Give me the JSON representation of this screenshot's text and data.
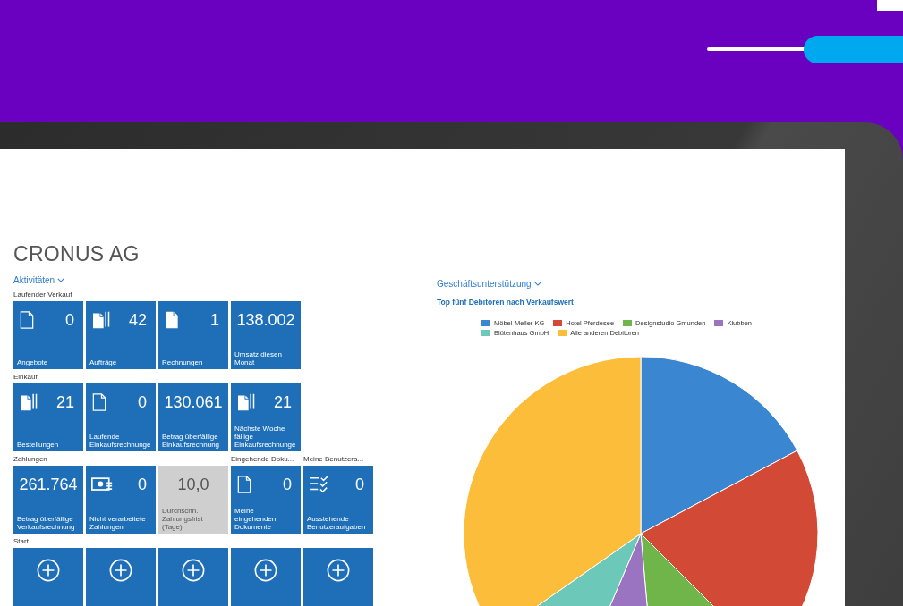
{
  "company": "CRONUS AG",
  "activities": {
    "link": "Aktivitäten",
    "rows": [
      {
        "groups": [
          {
            "title": "Laufender Verkauf",
            "tiles": [
              {
                "kind": "page",
                "value": "0",
                "label": "Angebote"
              },
              {
                "kind": "pages",
                "value": "42",
                "label": "Aufträge"
              },
              {
                "kind": "filled",
                "value": "1",
                "label": "Rechnungen"
              },
              {
                "kind": "figure",
                "value": "138.002",
                "label": "Umsatz diesen Monat"
              }
            ]
          }
        ]
      },
      {
        "groups": [
          {
            "title": "Einkauf",
            "tiles": [
              {
                "kind": "pages",
                "value": "21",
                "label": "Bestellungen"
              },
              {
                "kind": "page",
                "value": "0",
                "label": "Laufende Einkaufsrechnunge"
              },
              {
                "kind": "figure",
                "value": "130.061",
                "label": "Betrag überfällige Einkaufsrechnung"
              },
              {
                "kind": "pages",
                "value": "21",
                "label": "Nächste Woche fällige Einkaufsrechnunge"
              }
            ]
          }
        ]
      },
      {
        "groups": [
          {
            "title": "Zahlungen",
            "tiles": [
              {
                "kind": "figure",
                "value": "261.764",
                "label": "Betrag überfällige Verkaufsrechnung"
              },
              {
                "kind": "payment",
                "value": "0",
                "label": "Nicht verarbeitete Zahlungen"
              },
              {
                "kind": "neutral",
                "value": "10,0",
                "label": "Durchschn. Zahlungsfrist (Tage)"
              }
            ]
          },
          {
            "title": "Eingehende Doku...",
            "tiles": [
              {
                "kind": "page",
                "value": "0",
                "label": "Meine eingehenden Dokumente"
              }
            ]
          },
          {
            "title": "Meine Benutzera...",
            "tiles": [
              {
                "kind": "tasks",
                "value": "0",
                "label": "Ausstehende Benutzeraufgaben"
              }
            ]
          }
        ]
      },
      {
        "groups": [
          {
            "title": "Start",
            "tiles": [
              {
                "kind": "add"
              },
              {
                "kind": "add"
              },
              {
                "kind": "add"
              },
              {
                "kind": "add"
              },
              {
                "kind": "add"
              }
            ]
          }
        ]
      }
    ]
  },
  "support": {
    "link": "Geschäftsunterstützung",
    "chart_title": "Top fünf Debitoren nach Verkaufswert",
    "legend": [
      {
        "name": "Möbel-Meller KG",
        "color": "#3a86d0"
      },
      {
        "name": "Hotel Pferdesee",
        "color": "#d24a35"
      },
      {
        "name": "Designstudio Gmunden",
        "color": "#6fb54a"
      },
      {
        "name": "Klubben",
        "color": "#9a74c0"
      },
      {
        "name": "Blütenhaus GmbH",
        "color": "#6cc9ba"
      },
      {
        "name": "Alle anderen Debitoren",
        "color": "#fbbd3a"
      }
    ]
  }
}
